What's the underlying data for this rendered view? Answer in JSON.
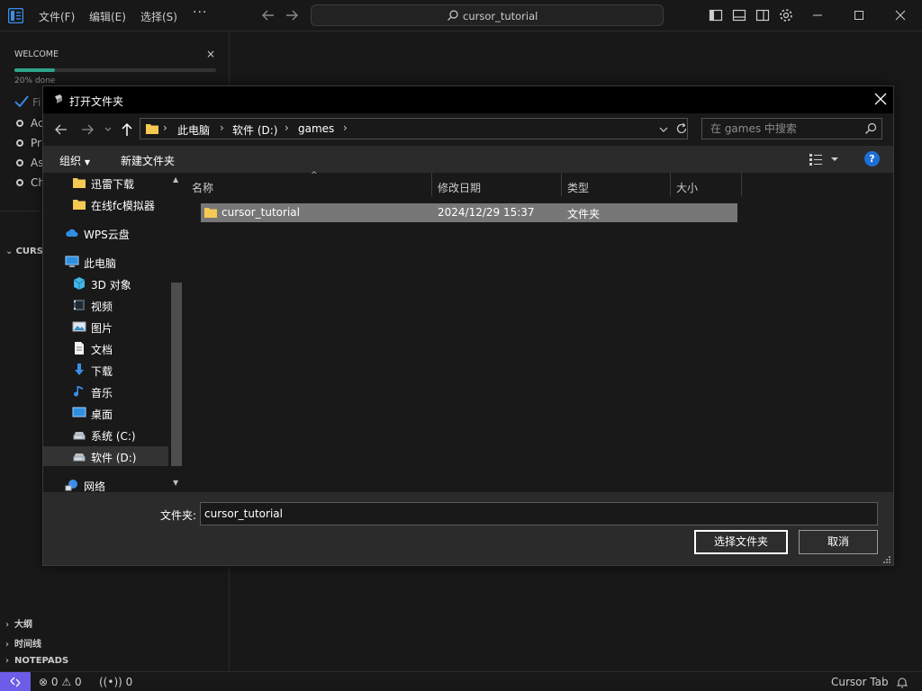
{
  "menu": {
    "file": "文件(F)",
    "edit": "编辑(E)",
    "selection": "选择(S)",
    "more": "···"
  },
  "command_center": {
    "text": "cursor_tutorial"
  },
  "welcome": {
    "title": "WELCOME",
    "close": "×",
    "progress_fraction": 0.2,
    "progress_label": "20% done",
    "steps": [
      {
        "label": "Fi",
        "state": "done"
      },
      {
        "label": "Ac",
        "state": "todo"
      },
      {
        "label": "Pr",
        "state": "todo"
      },
      {
        "label": "As",
        "state": "todo"
      },
      {
        "label": "Ch",
        "state": "todo"
      }
    ]
  },
  "sidebar": {
    "cursor_section": "CURS",
    "bottom_sections": [
      {
        "label": "大纲"
      },
      {
        "label": "时间线"
      },
      {
        "label": "NOTEPADS"
      }
    ]
  },
  "statusbar": {
    "errors": "0",
    "warnings": "0",
    "ports": "0",
    "cursor_tab": "Cursor Tab"
  },
  "dialog": {
    "title": "打开文件夹",
    "breadcrumb": [
      "此电脑",
      "软件 (D:)",
      "games"
    ],
    "search_placeholder": "在 games 中搜索",
    "organize": "组织",
    "new_folder": "新建文件夹",
    "help": "?",
    "nav_items": [
      {
        "label": "迅雷下载",
        "icon": "folder-icon",
        "indent": 1
      },
      {
        "label": "在线fc模拟器",
        "icon": "folder-icon",
        "indent": 1
      },
      {
        "label": "WPS云盘",
        "icon": "cloud-icon",
        "indent": 0
      },
      {
        "label": "此电脑",
        "icon": "computer-icon",
        "indent": 0
      },
      {
        "label": "3D 对象",
        "icon": "cube-icon",
        "indent": 1
      },
      {
        "label": "视频",
        "icon": "video-icon",
        "indent": 1
      },
      {
        "label": "图片",
        "icon": "picture-icon",
        "indent": 1
      },
      {
        "label": "文档",
        "icon": "document-icon",
        "indent": 1
      },
      {
        "label": "下载",
        "icon": "download-icon",
        "indent": 1
      },
      {
        "label": "音乐",
        "icon": "music-icon",
        "indent": 1
      },
      {
        "label": "桌面",
        "icon": "desktop-icon",
        "indent": 1
      },
      {
        "label": "系统 (C:)",
        "icon": "drive-icon",
        "indent": 1
      },
      {
        "label": "软件 (D:)",
        "icon": "drive-icon",
        "indent": 1,
        "selected": true
      },
      {
        "label": "网络",
        "icon": "network-icon",
        "indent": 0
      }
    ],
    "columns": {
      "name": "名称",
      "modified": "修改日期",
      "type": "类型",
      "size": "大小"
    },
    "files": [
      {
        "name": "cursor_tutorial",
        "modified": "2024/12/29 15:37",
        "type": "文件夹",
        "size": ""
      }
    ],
    "folder_label": "文件夹:",
    "folder_value": "cursor_tutorial",
    "select_button": "选择文件夹",
    "cancel_button": "取消"
  }
}
